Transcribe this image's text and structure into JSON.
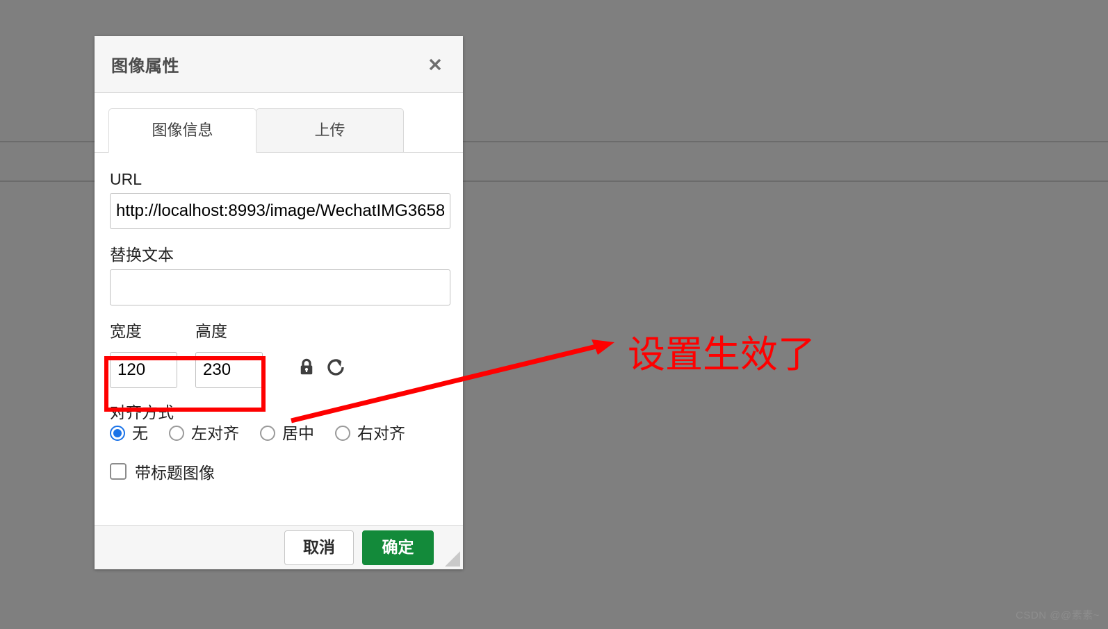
{
  "background": {
    "color": "#7f7f7f",
    "rule_color": "#6b6b6b"
  },
  "dialog": {
    "title": "图像属性",
    "close_icon": "close-icon",
    "tabs": [
      {
        "label": "图像信息",
        "active": true
      },
      {
        "label": "上传",
        "active": false
      }
    ],
    "fields": {
      "url": {
        "label": "URL",
        "value": "http://localhost:8993/image/WechatIMG3658",
        "placeholder": ""
      },
      "alt": {
        "label": "替换文本",
        "value": "",
        "placeholder": ""
      },
      "width": {
        "label": "宽度",
        "value": "120",
        "placeholder": ""
      },
      "height": {
        "label": "高度",
        "value": "230",
        "placeholder": ""
      },
      "lock_icon": "lock-icon",
      "reset_icon": "reset-icon"
    },
    "alignment": {
      "label": "对齐方式",
      "options": [
        {
          "label": "无",
          "checked": true
        },
        {
          "label": "左对齐",
          "checked": false
        },
        {
          "label": "居中",
          "checked": false
        },
        {
          "label": "右对齐",
          "checked": false
        }
      ]
    },
    "caption": {
      "label": "带标题图像",
      "checked": false
    },
    "footer": {
      "cancel_label": "取消",
      "ok_label": "确定",
      "ok_color": "#138a3a"
    }
  },
  "annotation": {
    "text": "设置生效了",
    "color": "#fe0000",
    "highlight_color": "#fe0000"
  },
  "watermark": {
    "text": "CSDN @@素素~"
  }
}
